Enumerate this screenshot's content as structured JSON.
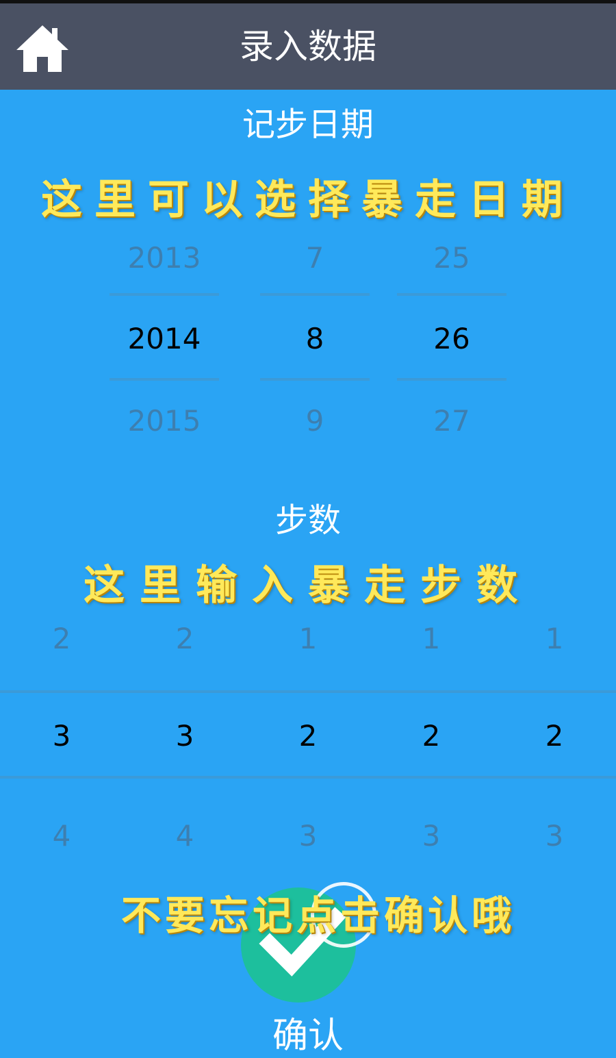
{
  "header": {
    "title": "录入数据",
    "home_icon": "home-icon"
  },
  "date_section": {
    "label": "记步日期",
    "hint": "这里可以选择暴走日期",
    "columns": [
      {
        "name": "year",
        "prev": "2013",
        "current": "2014",
        "next": "2015"
      },
      {
        "name": "month",
        "prev": "7",
        "current": "8",
        "next": "9"
      },
      {
        "name": "day",
        "prev": "25",
        "current": "26",
        "next": "27"
      }
    ]
  },
  "steps_section": {
    "label": "步数",
    "hint": "这里输入暴走步数",
    "digits": [
      {
        "prev": "2",
        "current": "3",
        "next": "4"
      },
      {
        "prev": "2",
        "current": "3",
        "next": "4"
      },
      {
        "prev": "1",
        "current": "2",
        "next": "3"
      },
      {
        "prev": "1",
        "current": "2",
        "next": "3"
      },
      {
        "prev": "1",
        "current": "2",
        "next": "3"
      }
    ]
  },
  "confirm": {
    "hint": "不要忘记点击确认哦",
    "label": "确认",
    "icon": "checkmark-icon"
  },
  "colors": {
    "background": "#2aa4f4",
    "header": "#4a5163",
    "hint_text": "#ffe95a",
    "confirm_button": "#1dbf9d"
  }
}
